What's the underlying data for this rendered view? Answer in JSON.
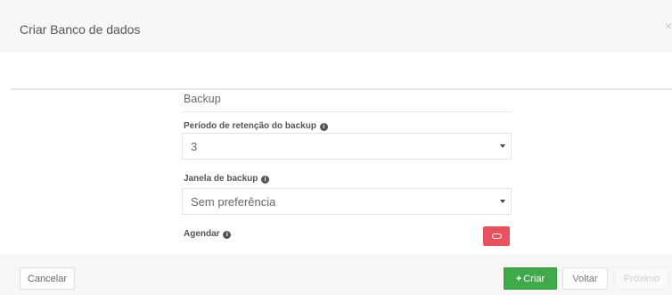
{
  "dialog": {
    "title": "Criar Banco de dados",
    "close_glyph": "×"
  },
  "section": {
    "title": "Backup"
  },
  "fields": {
    "retention": {
      "label": "Período de retenção do backup",
      "value": "3",
      "info_icon": "info-icon"
    },
    "window": {
      "label": "Janela de backup",
      "value": "Sem preferência",
      "info_icon": "info-icon"
    },
    "schedule": {
      "label": "Agendar",
      "toggle_state": "off",
      "toggle_icon": "link-icon",
      "toggle_color": "#e8525f",
      "info_icon": "info-icon"
    }
  },
  "info_glyph": "i",
  "footer": {
    "cancel_label": "Cancelar",
    "create_icon": "plus-icon",
    "create_glyph": "+",
    "create_label": "Criar",
    "create_color": "#3faa4a",
    "back_label": "Voltar",
    "next_label": "Próximo"
  }
}
